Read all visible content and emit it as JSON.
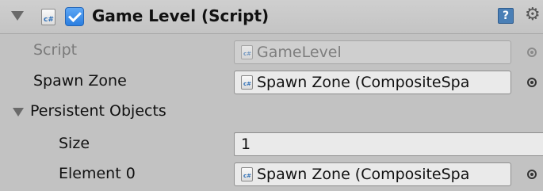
{
  "header": {
    "component_title": "Game Level (Script)",
    "enabled": true,
    "icons": [
      "foldout-arrow-icon",
      "csharp-script-icon",
      "help-icon",
      "gear-icon"
    ]
  },
  "rows": {
    "script": {
      "label": "Script",
      "value": "GameLevel"
    },
    "spawn_zone": {
      "label": "Spawn Zone",
      "value": "Spawn Zone (CompositeSpa"
    },
    "persistent_objects": {
      "label": "Persistent Objects",
      "size_label": "Size",
      "size_value": "1",
      "element0_label": "Element 0",
      "element0_value": "Spawn Zone (CompositeSpa"
    }
  },
  "colors": {
    "background": "#c2c2c2",
    "checkbox": "#2a7ee0",
    "help_icon": "#4a7fb6",
    "disabled_text": "#7b7b7b"
  }
}
